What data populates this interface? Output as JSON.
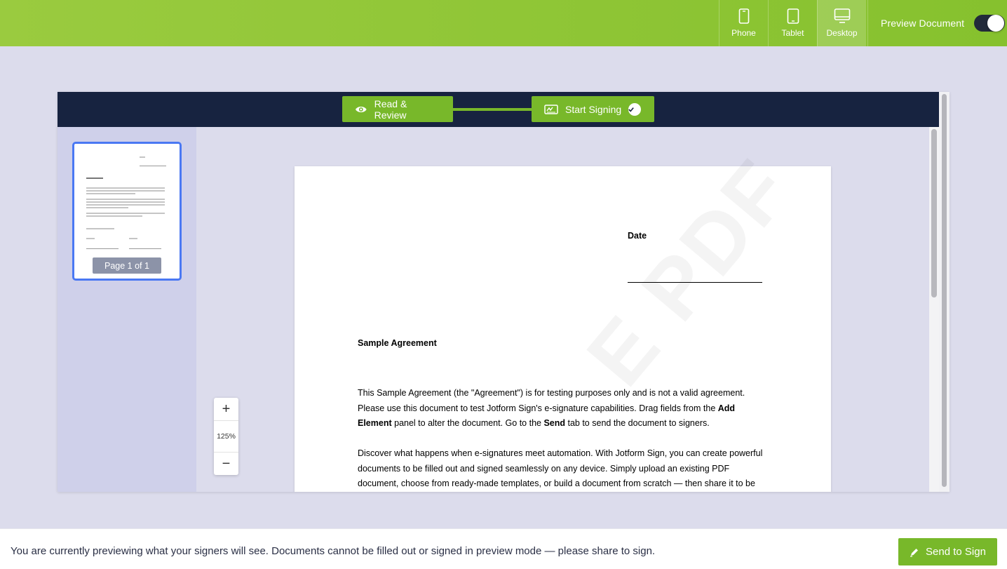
{
  "topbar": {
    "devices": [
      {
        "label": "Phone",
        "icon": "phone-icon",
        "active": false
      },
      {
        "label": "Tablet",
        "icon": "tablet-icon",
        "active": false
      },
      {
        "label": "Desktop",
        "icon": "desktop-icon",
        "active": true
      }
    ],
    "preview_label": "Preview Document",
    "preview_on": true
  },
  "viewer": {
    "steps": [
      {
        "label": "Read & Review",
        "icon": "eye-icon"
      },
      {
        "label": "Start Signing",
        "icon": "signature-icon",
        "completed": true
      }
    ],
    "thumbnail_label": "Page 1 of 1",
    "zoom": {
      "value": "125%",
      "in": "+",
      "out": "−"
    }
  },
  "document": {
    "watermark": "E PDF",
    "date_label": "Date",
    "title": "Sample Agreement",
    "para1_a": "This Sample Agreement (the \"Agreement\") is for testing purposes only and is not a valid agreement. Please use this document to test Jotform Sign's e-signature capabilities. Drag fields from the ",
    "para1_b": "Add Element",
    "para1_c": " panel to alter the document. Go to the ",
    "para1_d": "Send",
    "para1_e": " tab to send the document to signers.",
    "para2": "Discover what happens when e-signatures meet automation. With Jotform Sign, you can create powerful documents to be filled out and signed seamlessly on any device. Simply upload an existing PDF document, choose from ready-made templates, or build a document from scratch — then share it to be"
  },
  "bottombar": {
    "notice": "You are currently previewing what your signers will see. Documents cannot be filled out or signed in preview mode — please share to sign.",
    "send_label": "Send to Sign"
  },
  "colors": {
    "brand_green": "#78b82a",
    "header_navy": "#172340",
    "active_border": "#4a78f3"
  }
}
